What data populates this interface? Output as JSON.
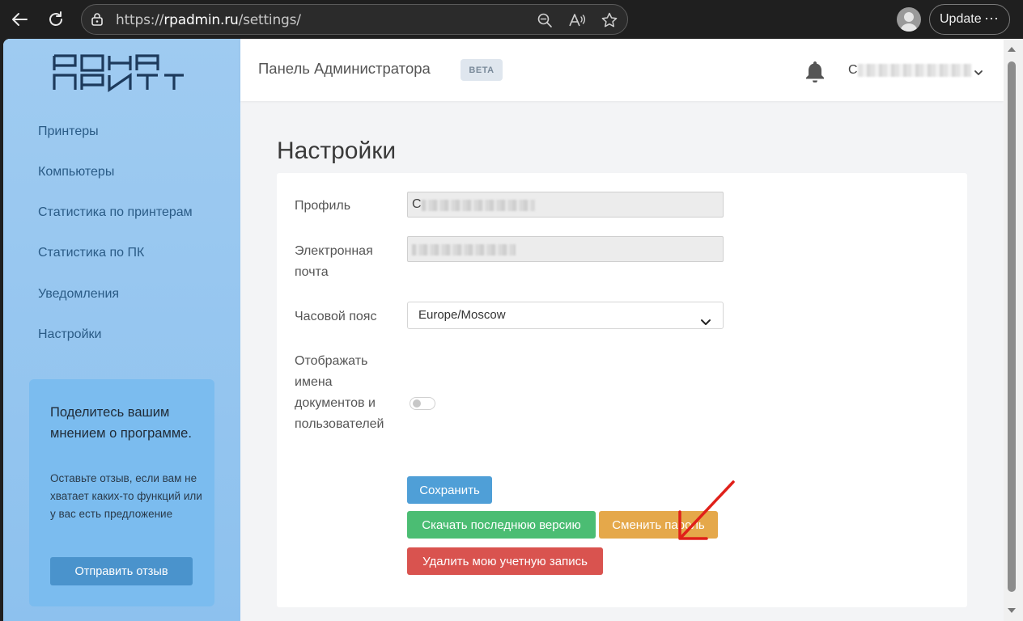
{
  "browser": {
    "url_prefix": "https://",
    "url_host": "rpadmin.ru",
    "url_path": "/settings/",
    "update_label": "Update",
    "more_label": "⋯"
  },
  "sidebar": {
    "items": [
      {
        "label": "Принтеры"
      },
      {
        "label": "Компьютеры"
      },
      {
        "label": "Статистика по принтерам"
      },
      {
        "label": "Статистика по ПК"
      },
      {
        "label": "Уведомления"
      },
      {
        "label": "Настройки"
      }
    ],
    "feedback": {
      "title": "Поделитесь вашим мнением о программе.",
      "text": "Оставьте отзыв, если вам не хватает каких-то функций или у вас есть предложение",
      "button_label": "Отправить отзыв"
    }
  },
  "header": {
    "title": "Панель Администратора",
    "badge": "BETA",
    "user_initial": "С"
  },
  "main": {
    "title": "Настройки",
    "fields": {
      "profile_label": "Профиль",
      "profile_value": "С",
      "email_label": "Электронная почта",
      "timezone_label": "Часовой пояс",
      "timezone_value": "Europe/Moscow",
      "show_names_label": "Отображать имена документов и пользователей"
    },
    "toggle_show_names_on": false,
    "buttons": {
      "save": "Сохранить",
      "download": "Скачать последнюю версию",
      "change_password": "Сменить пароль",
      "delete_account": "Удалить мою учетную запись"
    }
  },
  "colors": {
    "sidebar": "#9fcbf1",
    "nav_text": "#2a5b86",
    "save": "#4f9fd7",
    "download": "#4bbd73",
    "change_password": "#e5a84a",
    "delete": "#d9534f",
    "annotation_arrow": "#e0201a"
  }
}
